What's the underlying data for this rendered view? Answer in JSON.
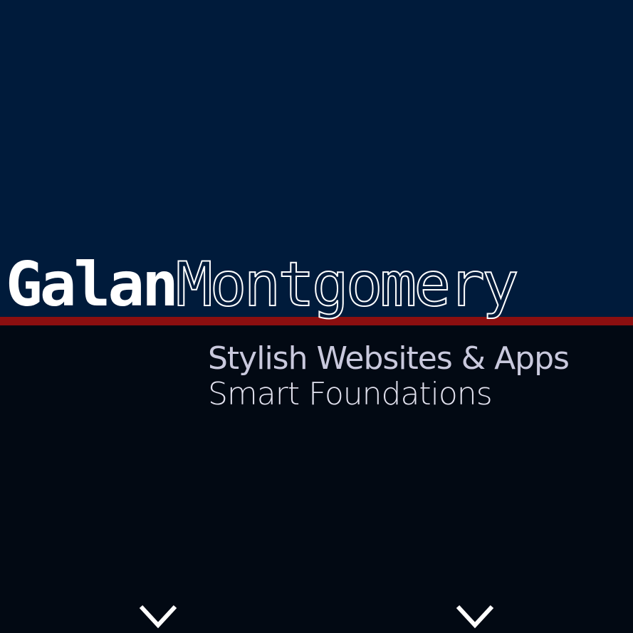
{
  "brand": {
    "first_name": "Galan",
    "last_name": "Montgomery"
  },
  "tagline": {
    "line1": "Stylish Websites & Apps",
    "line2": "Smart Foundations"
  },
  "colors": {
    "top_background": "#001b3b",
    "bottom_background": "#020913",
    "accent_bar": "#8b0f10",
    "text": "#ffffff",
    "tagline": "#c9c9dd"
  },
  "icons": {
    "scroll_left": "chevron-down-icon",
    "scroll_right": "chevron-down-icon"
  }
}
